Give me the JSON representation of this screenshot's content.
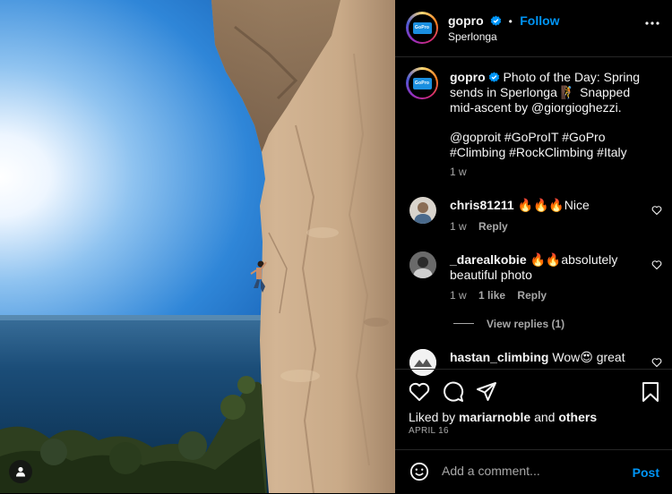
{
  "post": {
    "username": "gopro",
    "follow_label": "Follow",
    "separator": "•",
    "location": "Sperlonga",
    "logo_text": "GoPro"
  },
  "caption": {
    "username": "gopro",
    "line1": "Photo of the Day: Spring",
    "line2": "sends in Sperlonga 🧗 Snapped",
    "line3": "mid-ascent by @giorgioghezzi.",
    "line4": "@goproit #GoProIT #GoPro",
    "line5": "#Climbing #RockClimbing #Italy",
    "time": "1 w"
  },
  "comments": [
    {
      "username": "chris81211",
      "text": "🔥🔥🔥Nice",
      "time": "1 w",
      "reply_label": "Reply"
    },
    {
      "username": "_darealkobie",
      "text_line1": "🔥🔥absolutely",
      "text_line2": "beautiful photo",
      "time": "1 w",
      "likes": "1 like",
      "reply_label": "Reply",
      "view_replies": "View replies (1)"
    },
    {
      "username": "hastan_climbing",
      "text": "Wow😍 great"
    }
  ],
  "actions": {
    "liked_prefix": "Liked by",
    "liked_user": "mariarnoble",
    "liked_and": "and",
    "liked_others": "others",
    "date": "APRIL 16"
  },
  "add_comment": {
    "placeholder": "Add a comment...",
    "post_label": "Post"
  },
  "icons": {
    "verified": "verified-badge-icon",
    "more": "more-options-icon",
    "heart": "heart-icon",
    "comment": "comment-bubble-icon",
    "share": "share-plane-icon",
    "bookmark": "bookmark-icon",
    "emoji": "emoji-smiley-icon",
    "user_tag": "user-tag-icon"
  },
  "colors": {
    "accent": "#0095f6",
    "background": "#000000",
    "secondary_text": "#a8a8a8",
    "divider": "#262626"
  }
}
